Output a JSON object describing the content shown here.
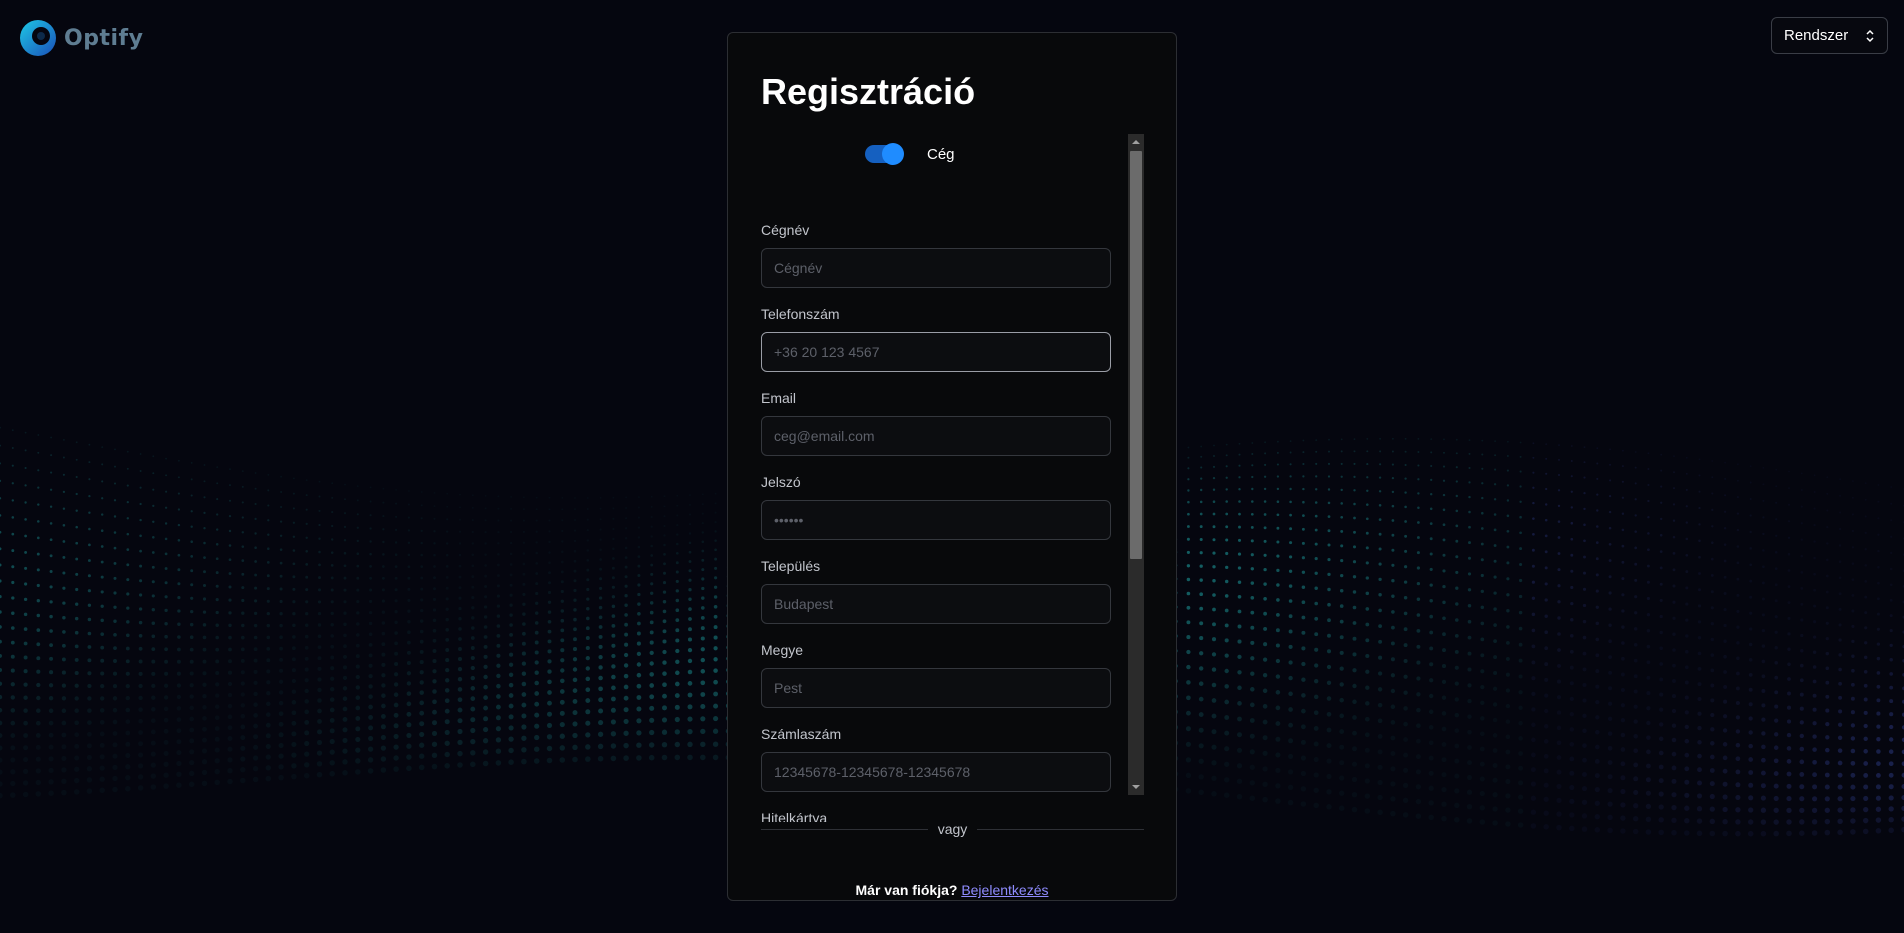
{
  "brand": {
    "name": "Optify"
  },
  "theme_select": {
    "value": "Rendszer"
  },
  "card": {
    "title": "Regisztráció",
    "account_type_label": "Cég",
    "account_type_company_enabled": true,
    "fields": [
      {
        "label": "Cégnév",
        "placeholder": "Cégnév"
      },
      {
        "label": "Telefonszám",
        "placeholder": "+36 20 123 4567"
      },
      {
        "label": "Email",
        "placeholder": "ceg@email.com"
      },
      {
        "label": "Jelszó",
        "placeholder": "••••••"
      },
      {
        "label": "Település",
        "placeholder": "Budapest"
      },
      {
        "label": "Megye",
        "placeholder": "Pest"
      },
      {
        "label": "Számlaszám",
        "placeholder": "12345678-12345678-12345678"
      },
      {
        "label": "Hitelkártya"
      }
    ],
    "divider_text": "vagy",
    "signin_question": "Már van fiókja?",
    "signin_link": "Bejelentkezés"
  },
  "colors": {
    "background": "#05060f",
    "accent": "#1f8cff",
    "link": "#8f8cff",
    "wave_teal": "#1fa6a6",
    "wave_blue": "#4a5fd6"
  },
  "icons": {
    "theme_select": "chevron-up-down-icon",
    "scroll_up": "triangle-up-icon",
    "scroll_down": "triangle-down-icon"
  }
}
